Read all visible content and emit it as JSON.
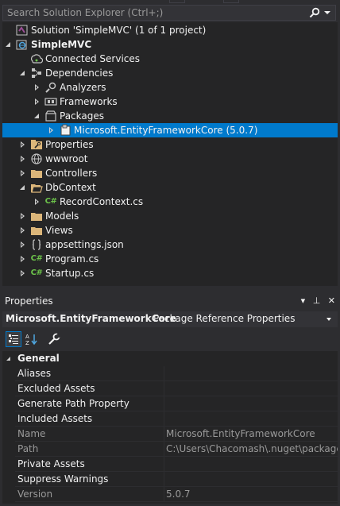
{
  "search": {
    "placeholder": "Search Solution Explorer (Ctrl+;)",
    "icon": "search-icon"
  },
  "tree": [
    {
      "label": "Solution 'SimpleMVC' (1 of 1 project)",
      "icon": "solution-icon",
      "expander": "none",
      "level": 0,
      "bold": false,
      "selected": false
    },
    {
      "label": "SimpleMVC",
      "icon": "project-icon",
      "expander": "expanded",
      "level": 0,
      "bold": true,
      "selected": false
    },
    {
      "label": "Connected Services",
      "icon": "connected-services-icon",
      "expander": "none",
      "level": 1,
      "bold": false,
      "selected": false
    },
    {
      "label": "Dependencies",
      "icon": "dependencies-icon",
      "expander": "expanded",
      "level": 1,
      "bold": false,
      "selected": false
    },
    {
      "label": "Analyzers",
      "icon": "analyzers-icon",
      "expander": "collapsed",
      "level": 2,
      "bold": false,
      "selected": false
    },
    {
      "label": "Frameworks",
      "icon": "frameworks-icon",
      "expander": "collapsed",
      "level": 2,
      "bold": false,
      "selected": false
    },
    {
      "label": "Packages",
      "icon": "packages-icon",
      "expander": "expanded",
      "level": 2,
      "bold": false,
      "selected": false
    },
    {
      "label": "Microsoft.EntityFrameworkCore (5.0.7)",
      "icon": "package-icon",
      "expander": "collapsed",
      "level": 3,
      "bold": false,
      "selected": true
    },
    {
      "label": "Properties",
      "icon": "properties-wrench-icon",
      "expander": "collapsed",
      "level": 1,
      "bold": false,
      "selected": false
    },
    {
      "label": "wwwroot",
      "icon": "globe-icon",
      "expander": "collapsed",
      "level": 1,
      "bold": false,
      "selected": false
    },
    {
      "label": "Controllers",
      "icon": "folder-icon",
      "expander": "collapsed",
      "level": 1,
      "bold": false,
      "selected": false
    },
    {
      "label": "DbContext",
      "icon": "folder-open-icon",
      "expander": "expanded",
      "level": 1,
      "bold": false,
      "selected": false
    },
    {
      "label": "RecordContext.cs",
      "icon": "csharp-file-icon",
      "expander": "collapsed",
      "level": 2,
      "bold": false,
      "selected": false
    },
    {
      "label": "Models",
      "icon": "folder-icon",
      "expander": "collapsed",
      "level": 1,
      "bold": false,
      "selected": false
    },
    {
      "label": "Views",
      "icon": "folder-icon",
      "expander": "collapsed",
      "level": 1,
      "bold": false,
      "selected": false
    },
    {
      "label": "appsettings.json",
      "icon": "json-file-icon",
      "expander": "collapsed",
      "level": 1,
      "bold": false,
      "selected": false
    },
    {
      "label": "Program.cs",
      "icon": "csharp-file-icon",
      "expander": "collapsed",
      "level": 1,
      "bold": false,
      "selected": false
    },
    {
      "label": "Startup.cs",
      "icon": "csharp-file-icon",
      "expander": "collapsed",
      "level": 1,
      "bold": false,
      "selected": false
    }
  ],
  "properties": {
    "title": "Properties",
    "object_name": "Microsoft.EntityFrameworkCore",
    "object_type": "Package Reference Properties",
    "category": "General",
    "rows": [
      {
        "name": "Aliases",
        "value": "",
        "readonly": false
      },
      {
        "name": "Excluded Assets",
        "value": "",
        "readonly": false
      },
      {
        "name": "Generate Path Property",
        "value": "",
        "readonly": false
      },
      {
        "name": "Included Assets",
        "value": "",
        "readonly": false
      },
      {
        "name": "Name",
        "value": "Microsoft.EntityFrameworkCore",
        "readonly": true
      },
      {
        "name": "Path",
        "value": "C:\\Users\\Chacomash\\.nuget\\packages\\",
        "readonly": true
      },
      {
        "name": "Private Assets",
        "value": "",
        "readonly": false
      },
      {
        "name": "Suppress Warnings",
        "value": "",
        "readonly": false
      },
      {
        "name": "Version",
        "value": "5.0.7",
        "readonly": true
      }
    ]
  },
  "colors": {
    "background": "#252526",
    "chrome": "#2d2d30",
    "selection": "#007acc",
    "text": "#f1f1f1",
    "dim_text": "#999999"
  }
}
